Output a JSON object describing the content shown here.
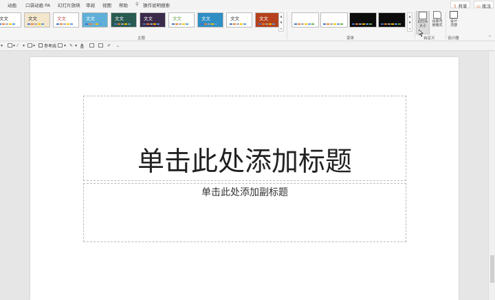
{
  "menu": {
    "items": [
      "动画",
      "口袋动画 PA",
      "幻灯片放映",
      "审阅",
      "视图",
      "帮助"
    ],
    "search_label": "操作说明搜索",
    "share_label": "共享",
    "comments_label": "批注"
  },
  "ribbon": {
    "themes": [
      {
        "text": "文文",
        "bg": "#ffffff",
        "fg": "#333333"
      },
      {
        "text": "文文",
        "bg": "#f3e6cc",
        "fg": "#333333"
      },
      {
        "text": "文文",
        "bg": "#ffffff",
        "fg": "#c0504d"
      },
      {
        "text": "文文",
        "bg": "#5fb0d8",
        "fg": "#ffffff"
      },
      {
        "text": "文文",
        "bg": "#2a5a52",
        "fg": "#ffffff"
      },
      {
        "text": "文文",
        "bg": "#3b2a4a",
        "fg": "#ffffff"
      },
      {
        "text": "文文",
        "bg": "#ffffff",
        "fg": "#6aa84f"
      },
      {
        "text": "文文",
        "bg": "#2f8fc4",
        "fg": "#ffffff"
      },
      {
        "text": "文文",
        "bg": "#ffffff",
        "fg": "#333333"
      },
      {
        "text": "文文",
        "bg": "#b5421c",
        "fg": "#ffffff"
      }
    ],
    "themes_group_label": "主题",
    "variants": [
      {
        "bg": "#ffffff"
      },
      {
        "bg": "#ffffff"
      },
      {
        "bg": "#0c0c0c"
      },
      {
        "bg": "#0c0c0c"
      }
    ],
    "variants_group_label": "变体",
    "slide_size_label": "幻灯片大小",
    "format_bg_label": "设置背景格式",
    "customize_group_label": "自定义",
    "design_ideas_label": "设计灵感",
    "designer_group_label": "设计器"
  },
  "toolbar": {
    "reference_line_label": "参考线"
  },
  "slide": {
    "title_placeholder": "单击此处添加标题",
    "subtitle_placeholder": "单击此处添加副标题"
  },
  "colors": {
    "accent": "#c55a11",
    "ribbon_bg": "#f5f5f5",
    "canvas_bg": "#e6e6e6"
  }
}
